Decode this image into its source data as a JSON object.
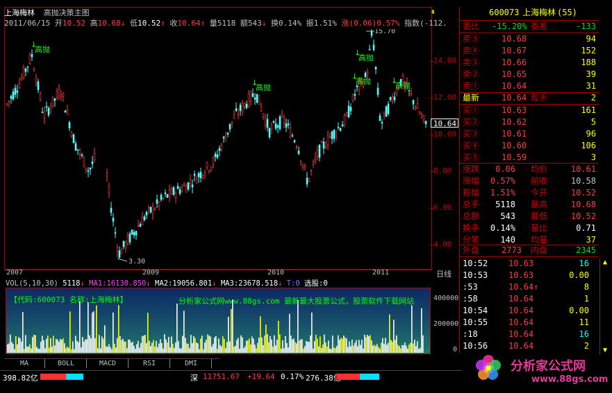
{
  "header": {
    "stock_name": "上海梅林",
    "indicator_title": "高抛决策主图",
    "date": "2011/06/15",
    "open_label": "开",
    "open": "10.52",
    "high_label": "高",
    "high": "10.68",
    "low_label": "低",
    "low": "10.52",
    "close_label": "收",
    "close": "10.64",
    "volume_label": "量",
    "volume": "5118",
    "amount_label": "额",
    "amount": "543",
    "turnover_label": "换",
    "turnover": "0.14%",
    "amplitude_label": "振",
    "amplitude": "1.51%",
    "change_label": "涨",
    "change": "(0.06)0.57%",
    "index_label": "指数",
    "index": "(-112."
  },
  "main_chart": {
    "y_ticks": [
      "14.00",
      "12.00",
      "10.00",
      "8.00",
      "6.00",
      "4.00"
    ],
    "x_labels": [
      "2007",
      "2009",
      "2010",
      "2011"
    ],
    "period_label": "日线",
    "max_label": "15.70",
    "min_label": "3.30",
    "current_price": "10.64",
    "signal_text": "高抛",
    "signals": 5
  },
  "volume_panel": {
    "title": "VOL(5,10,30)",
    "vol": "5118",
    "ma1_label": "MA1:",
    "ma1": "16130.850",
    "ma2_label": "MA2:",
    "ma2": "19056.801",
    "ma3_label": "MA3:",
    "ma3": "23678.518",
    "extra": "T:0",
    "select_label": "选股:0",
    "code_banner": "【代码:600073  名称:上海梅林】",
    "ad_text": "分析家公式网www.88gs.com 最新最大股票公式，股票软件下载网站",
    "y_ticks": [
      "400000",
      "200000",
      "0"
    ]
  },
  "tabs": [
    "MA",
    "BOLL",
    "MACD",
    "RSI",
    "DMI"
  ],
  "quote": {
    "code": "600073",
    "name": "上海梅林",
    "num": "(55)",
    "wb_label": "委比",
    "wb": "-15.20%",
    "wc_label": "委差",
    "wc": "-133",
    "sells": [
      {
        "label": "卖⑤",
        "price": "10.68",
        "vol": "94"
      },
      {
        "label": "卖④",
        "price": "10.67",
        "vol": "152"
      },
      {
        "label": "卖③",
        "price": "10.66",
        "vol": "188"
      },
      {
        "label": "卖②",
        "price": "10.65",
        "vol": "39"
      },
      {
        "label": "卖①",
        "price": "10.64",
        "vol": "31"
      }
    ],
    "last_label": "最新",
    "last": "10.64",
    "now_label": "现手",
    "now": "2",
    "buys": [
      {
        "label": "买①",
        "price": "10.63",
        "vol": "161"
      },
      {
        "label": "买②",
        "price": "10.62",
        "vol": "5"
      },
      {
        "label": "买③",
        "price": "10.61",
        "vol": "96"
      },
      {
        "label": "买④",
        "price": "10.60",
        "vol": "106"
      },
      {
        "label": "买⑤",
        "price": "10.59",
        "vol": "3"
      }
    ],
    "stats": [
      {
        "l1": "涨跌",
        "v1": "0.06",
        "l2": "均价",
        "v2": "10.61"
      },
      {
        "l1": "涨幅",
        "v1": "0.57%",
        "l2": "前收",
        "v2": "10.58"
      },
      {
        "l1": "振幅",
        "v1": "1.51%",
        "l2": "今开",
        "v2": "10.52"
      },
      {
        "l1": "总手",
        "v1": "5118",
        "l2": "最高",
        "v2": "10.68"
      },
      {
        "l1": "总额",
        "v1": "543",
        "l2": "最低",
        "v2": "10.52"
      },
      {
        "l1": "换手",
        "v1": "0.14%",
        "l2": "量比",
        "v2": "0.71"
      },
      {
        "l1": "分笔",
        "v1": "140",
        "l2": "均量",
        "v2": "37"
      }
    ],
    "outer_label": "外盘",
    "outer": "2773",
    "inner_label": "内盘",
    "inner": "2345",
    "ticks": [
      {
        "t": "10:52",
        "p": "10.63",
        "v": "16"
      },
      {
        "t": "10:53",
        "p": "10.63",
        "v": "0.00"
      },
      {
        "t": ":53",
        "p": "10.64↑",
        "v": "8"
      },
      {
        "t": ":58",
        "p": "10.64",
        "v": "1"
      },
      {
        "t": "10:54",
        "p": "10.64",
        "v": "0.00"
      },
      {
        "t": "10:55",
        "p": "10.64",
        "v": "11"
      },
      {
        "t": ":18",
        "p": "10.64",
        "v": "16"
      },
      {
        "t": "10:56",
        "p": "10.64",
        "v": "2"
      }
    ]
  },
  "status": {
    "left_amount": "398.82亿",
    "sz_label": "深",
    "sz_index": "11751.67",
    "sz_change": "+19.64",
    "sz_pct": "0.17%",
    "sz_amount": "276.38亿"
  },
  "logo": {
    "text": "分析家公式网",
    "url": "www.88gs.com"
  },
  "colors": {
    "up": "#ff3c3c",
    "down": "#00e000",
    "panel_border": "#b00000",
    "banner_top": "#0a2a63",
    "banner_bottom": "#1a7a6a"
  }
}
